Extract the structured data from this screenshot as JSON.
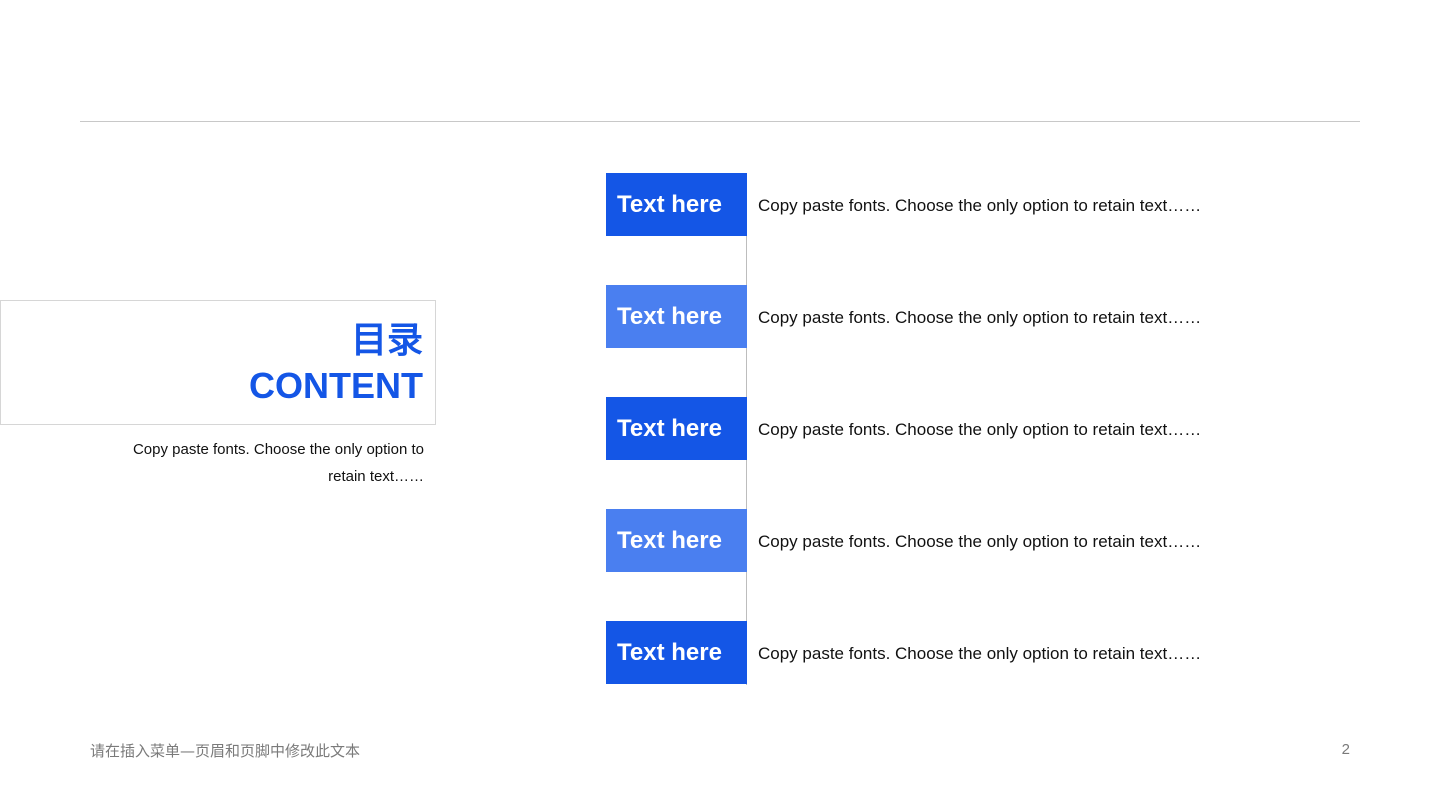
{
  "title": {
    "cn": "目录",
    "en": "CONTENT"
  },
  "intro": "Copy paste fonts. Choose the only option to retain text……",
  "items": [
    {
      "label": "Text here",
      "desc": "Copy paste fonts. Choose the only option to retain text……",
      "color": "#1456e6"
    },
    {
      "label": "Text here",
      "desc": "Copy paste fonts. Choose the only option to retain text……",
      "color": "#4a7ff0"
    },
    {
      "label": "Text here",
      "desc": "Copy paste fonts. Choose the only option to retain text……",
      "color": "#1456e6"
    },
    {
      "label": "Text here",
      "desc": "Copy paste fonts. Choose the only option to retain text……",
      "color": "#4a7ff0"
    },
    {
      "label": "Text here",
      "desc": "Copy paste fonts. Choose the only option to retain text……",
      "color": "#1456e6"
    }
  ],
  "footer": {
    "text": "请在插入菜单—页眉和页脚中修改此文本",
    "page_number": "2"
  },
  "colors": {
    "accent": "#1456e6",
    "accent_light": "#4a7ff0"
  }
}
